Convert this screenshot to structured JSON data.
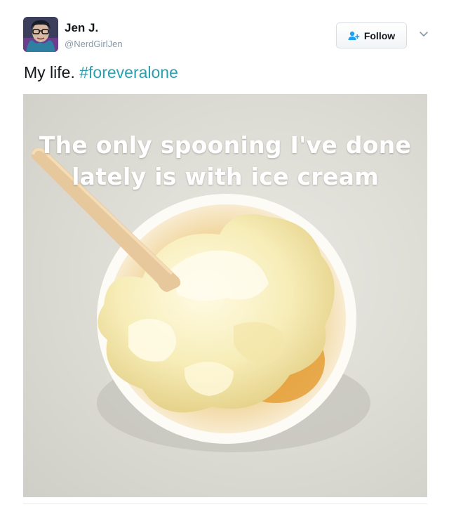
{
  "tweet": {
    "display_name": "Jen J.",
    "username": "@NerdGirlJen",
    "text_plain": "My life. ",
    "hashtag": "#foreveralone",
    "follow_label": "Follow"
  },
  "media": {
    "caption_line1": "The only spooning I've done",
    "caption_line2": "lately is with ice cream"
  },
  "colors": {
    "hashtag": "#2a9fae",
    "follow_icon": "#1da1f2"
  },
  "icons": [
    "follow-person-icon",
    "chevron-down-icon"
  ]
}
